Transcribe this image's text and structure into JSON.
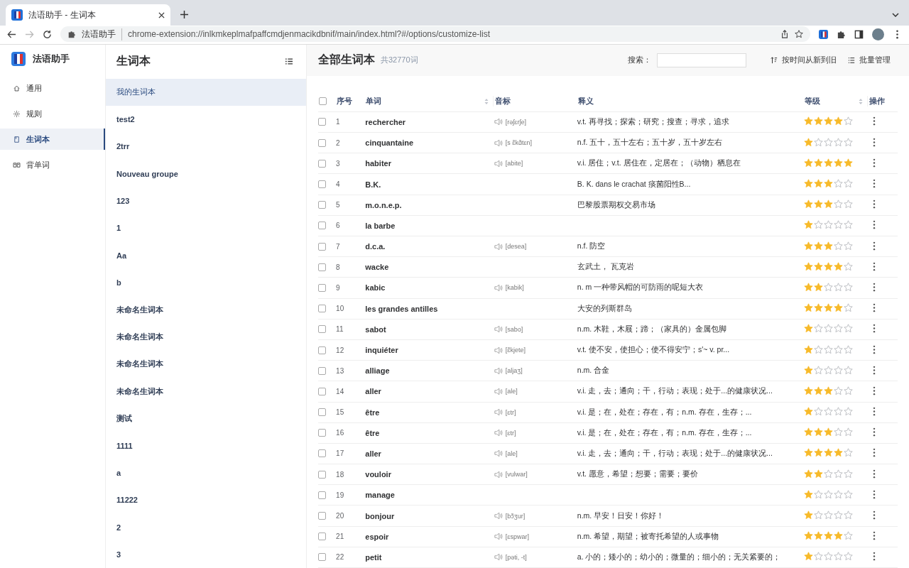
{
  "browser": {
    "tab_title": "法语助手 - 生词本",
    "site_name": "法语助手",
    "url": "chrome-extension://inlkmkeplmafpaffcmdjenmacikdbnif/main/index.html?#/options/customize-list"
  },
  "app": {
    "name": "法语助手"
  },
  "nav": [
    {
      "label": "通用",
      "selected": false
    },
    {
      "label": "规则",
      "selected": false
    },
    {
      "label": "生词本",
      "selected": true
    },
    {
      "label": "背单词",
      "selected": false
    }
  ],
  "groups": {
    "title": "生词本",
    "items": [
      {
        "label": "我的生词本",
        "selected": true
      },
      {
        "label": "test2",
        "selected": false
      },
      {
        "label": "2trr",
        "selected": false
      },
      {
        "label": "Nouveau groupe",
        "selected": false
      },
      {
        "label": "123",
        "selected": false
      },
      {
        "label": "1",
        "selected": false
      },
      {
        "label": "Aa",
        "selected": false
      },
      {
        "label": "b",
        "selected": false
      },
      {
        "label": "未命名生词本",
        "selected": false
      },
      {
        "label": "未命名生词本",
        "selected": false
      },
      {
        "label": "未命名生词本",
        "selected": false
      },
      {
        "label": "未命名生词本",
        "selected": false
      },
      {
        "label": "测试",
        "selected": false
      },
      {
        "label": "1111",
        "selected": false
      },
      {
        "label": "a",
        "selected": false
      },
      {
        "label": "11222",
        "selected": false
      },
      {
        "label": "2",
        "selected": false
      },
      {
        "label": "3",
        "selected": false
      }
    ]
  },
  "main": {
    "title": "全部生词本",
    "count": "共32770词",
    "search_label": "搜索：",
    "sort_button": "按时间从新到旧",
    "batch_button": "批量管理"
  },
  "table": {
    "select_all_checked": false,
    "columns": [
      {
        "label": "序号",
        "sortable": false
      },
      {
        "label": "单词",
        "sortable": true
      },
      {
        "label": "音标",
        "sortable": false
      },
      {
        "label": "释义",
        "sortable": false
      },
      {
        "label": "等级",
        "sortable": true
      },
      {
        "label": "操作",
        "sortable": false
      }
    ],
    "rows": [
      {
        "checked": false,
        "index": "1",
        "word": "rechercher",
        "phonetic": "[rəʃɛrʃe]",
        "meaning": "v.t. 再寻找；探索；研究；搜查；寻求，追求",
        "stars": 4
      },
      {
        "checked": false,
        "index": "2",
        "word": "cinquantaine",
        "phonetic": "[s ɛ̃kɑ̃tɛn]",
        "meaning": "n.f. 五十，五十左右；五十岁，五十岁左右",
        "stars": 1
      },
      {
        "checked": false,
        "index": "3",
        "word": "habiter",
        "phonetic": "[abite]",
        "meaning": "v.i. 居住；v.t. 居住在，定居在；（动物）栖息在",
        "stars": 5
      },
      {
        "checked": false,
        "index": "4",
        "word": "B.K.",
        "meaning": "B. K. dans le crachat 痰菌阳性B...",
        "stars": 3
      },
      {
        "checked": false,
        "index": "5",
        "word": "m.o.n.e.p.",
        "meaning": "巴黎股票期权交易市场",
        "stars": 3
      },
      {
        "checked": false,
        "index": "6",
        "word": "la barbe",
        "stars": 1
      },
      {
        "checked": false,
        "index": "7",
        "word": "d.c.a.",
        "phonetic": "[desea]",
        "meaning": "n.f. 防空",
        "stars": 3
      },
      {
        "checked": false,
        "index": "8",
        "word": "wacke",
        "meaning": "玄武土， 瓦克岩",
        "stars": 4
      },
      {
        "checked": false,
        "index": "9",
        "word": "kabic",
        "phonetic": "[kabik]",
        "meaning": "n. m 一种带风帽的可防雨的呢短大衣",
        "stars": 2
      },
      {
        "checked": false,
        "index": "10",
        "word": "les grandes antilles",
        "meaning": "大安的列斯群岛",
        "stars": 4
      },
      {
        "checked": false,
        "index": "11",
        "word": "sabot",
        "phonetic": "[sabo]",
        "meaning": "n.m. 木鞋，木屐；蹄；（家具的）金属包脚",
        "stars": 1
      },
      {
        "checked": false,
        "index": "12",
        "word": "inquiéter",
        "phonetic": "[ɛ̃kjete]",
        "meaning": "v.t. 使不安，使担心；使不得安宁；s'~ v. pr...",
        "stars": 1
      },
      {
        "checked": false,
        "index": "13",
        "word": "alliage",
        "phonetic": "[aljaʒ]",
        "meaning": "n.m. 合金",
        "stars": 1
      },
      {
        "checked": false,
        "index": "14",
        "word": "aller",
        "phonetic": "[ale]",
        "meaning": "v.i. 走，去；通向；干，行动；表现；处于...的健康状况...",
        "stars": 3
      },
      {
        "checked": false,
        "index": "15",
        "word": "être",
        "phonetic": "[ɛtr]",
        "meaning": "v.i. 是；在，处在；存在，有；n.m. 存在，生存；...",
        "stars": 1
      },
      {
        "checked": false,
        "index": "16",
        "word": "être",
        "phonetic": "[ɛtr]",
        "meaning": "v.i. 是；在，处在；存在，有；n.m. 存在，生存；...",
        "stars": 3
      },
      {
        "checked": false,
        "index": "17",
        "word": "aller",
        "phonetic": "[ale]",
        "meaning": "v.i. 走，去；通向；干，行动；表现；处于...的健康状况...",
        "stars": 4
      },
      {
        "checked": false,
        "index": "18",
        "word": "vouloir",
        "phonetic": "[vulwar]",
        "meaning": "v.t. 愿意，希望；想要；需要；要价",
        "stars": 2
      },
      {
        "checked": false,
        "index": "19",
        "word": "manage",
        "stars": 1
      },
      {
        "checked": false,
        "index": "20",
        "word": "bonjour",
        "phonetic": "[bɔ̃ʒur]",
        "meaning": "n.m. 早安！日安！你好！",
        "stars": 1
      },
      {
        "checked": false,
        "index": "21",
        "word": "espoir",
        "phonetic": "[ɛspwar]",
        "meaning": "n.m. 希望，期望；被寄托希望的人或事物",
        "stars": 4
      },
      {
        "checked": false,
        "index": "22",
        "word": "petit",
        "phonetic": "[pəti, -t]",
        "meaning": "a. 小的；矮小的；幼小的；微量的；细小的；无关紧要的；",
        "stars": 1
      }
    ]
  }
}
